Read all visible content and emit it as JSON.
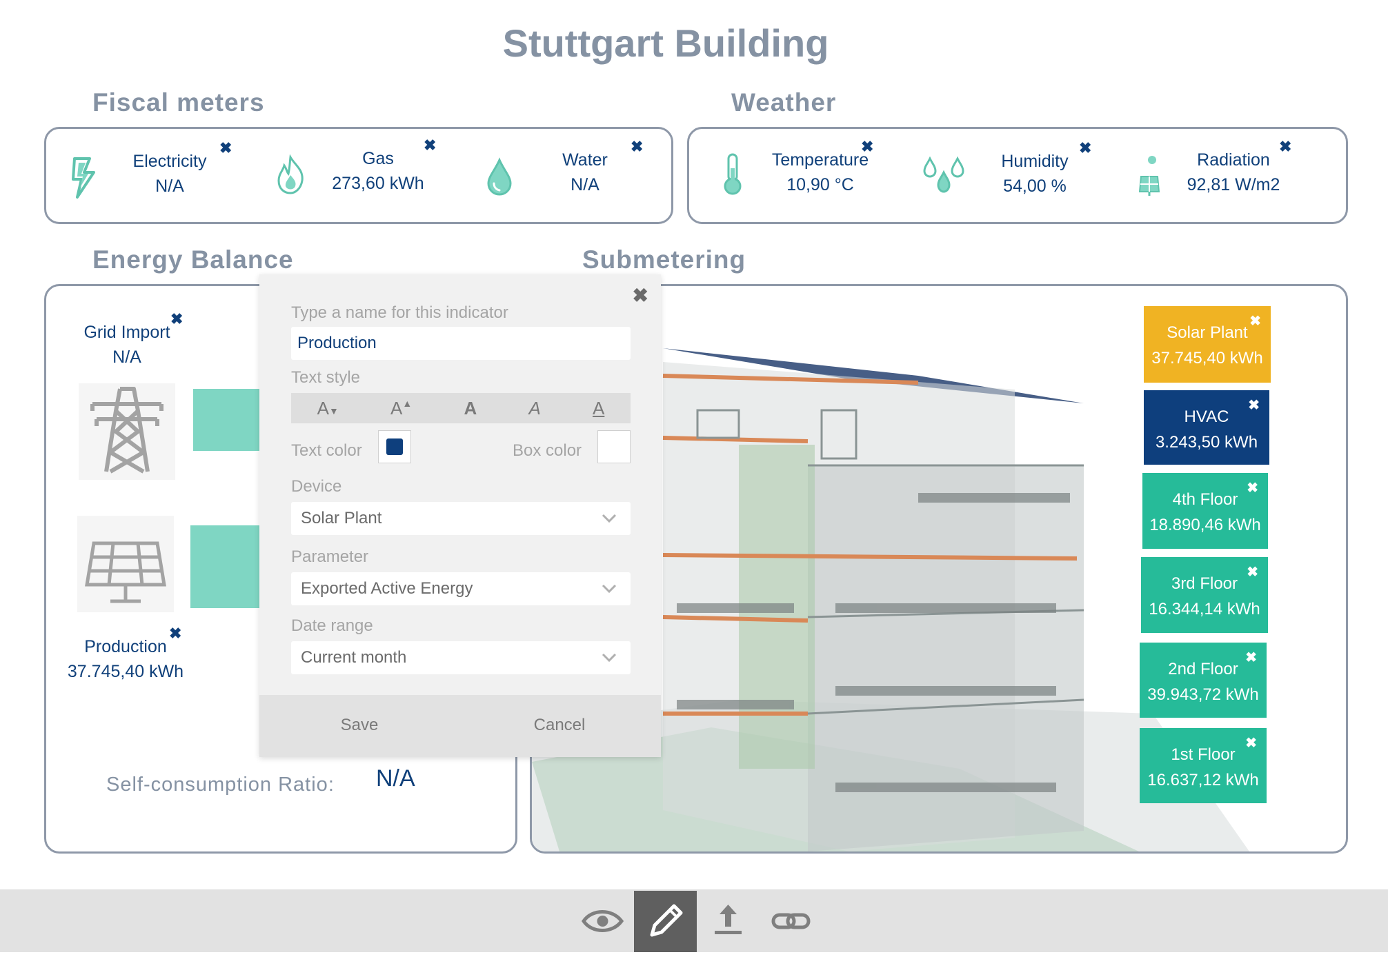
{
  "title": "Stuttgart Building",
  "sections": {
    "fiscal": "Fiscal meters",
    "weather": "Weather",
    "energy": "Energy Balance",
    "submetering": "Submetering"
  },
  "fiscal_meters": [
    {
      "label": "Electricity",
      "value": "N/A",
      "icon": "lightning-icon"
    },
    {
      "label": "Gas",
      "value": "273,60 kWh",
      "icon": "flame-icon"
    },
    {
      "label": "Water",
      "value": "N/A",
      "icon": "water-drop-icon"
    }
  ],
  "weather": [
    {
      "label": "Temperature",
      "value": "10,90 °C",
      "icon": "thermometer-icon"
    },
    {
      "label": "Humidity",
      "value": "54,00 %",
      "icon": "humidity-drops-icon"
    },
    {
      "label": "Radiation",
      "value": "92,81 W/m2",
      "icon": "solar-radiation-icon"
    }
  ],
  "energy_balance": {
    "grid_import_label": "Grid Import",
    "grid_import_value": "N/A",
    "production_label": "Production",
    "production_value": "37.745,40 kWh",
    "self_consumption_label": "Self-consumption Ratio:",
    "self_consumption_value": "N/A"
  },
  "submeters": [
    {
      "label": "Solar Plant",
      "value": "37.745,40 kWh",
      "color": "#f0b323"
    },
    {
      "label": "HVAC",
      "value": "3.243,50 kWh",
      "color": "#0e3f7d"
    },
    {
      "label": "4th Floor",
      "value": "18.890,46 kWh",
      "color": "#26bb99"
    },
    {
      "label": "3rd Floor",
      "value": "16.344,14 kWh",
      "color": "#26bb99"
    },
    {
      "label": "2nd Floor",
      "value": "39.943,72 kWh",
      "color": "#26bb99"
    },
    {
      "label": "1st Floor",
      "value": "16.637,12 kWh",
      "color": "#26bb99"
    }
  ],
  "dialog": {
    "name_label": "Type a name for this indicator",
    "name_value": "Production",
    "text_style_label": "Text style",
    "text_color_label": "Text color",
    "text_color": "#0e3f7d",
    "box_color_label": "Box color",
    "box_color": "#ffffff",
    "device_label": "Device",
    "device_value": "Solar Plant",
    "parameter_label": "Parameter",
    "parameter_value": "Exported Active Energy",
    "date_range_label": "Date range",
    "date_range_value": "Current month",
    "save_label": "Save",
    "cancel_label": "Cancel"
  },
  "toolbar": [
    "view-eye-icon",
    "edit-pencil-icon",
    "upload-icon",
    "link-icon"
  ],
  "colors": {
    "accent_navy": "#10407a",
    "heading_gray": "#8592a3",
    "teal": "#7fd6c3",
    "active_tool": "#5f5f5f"
  }
}
